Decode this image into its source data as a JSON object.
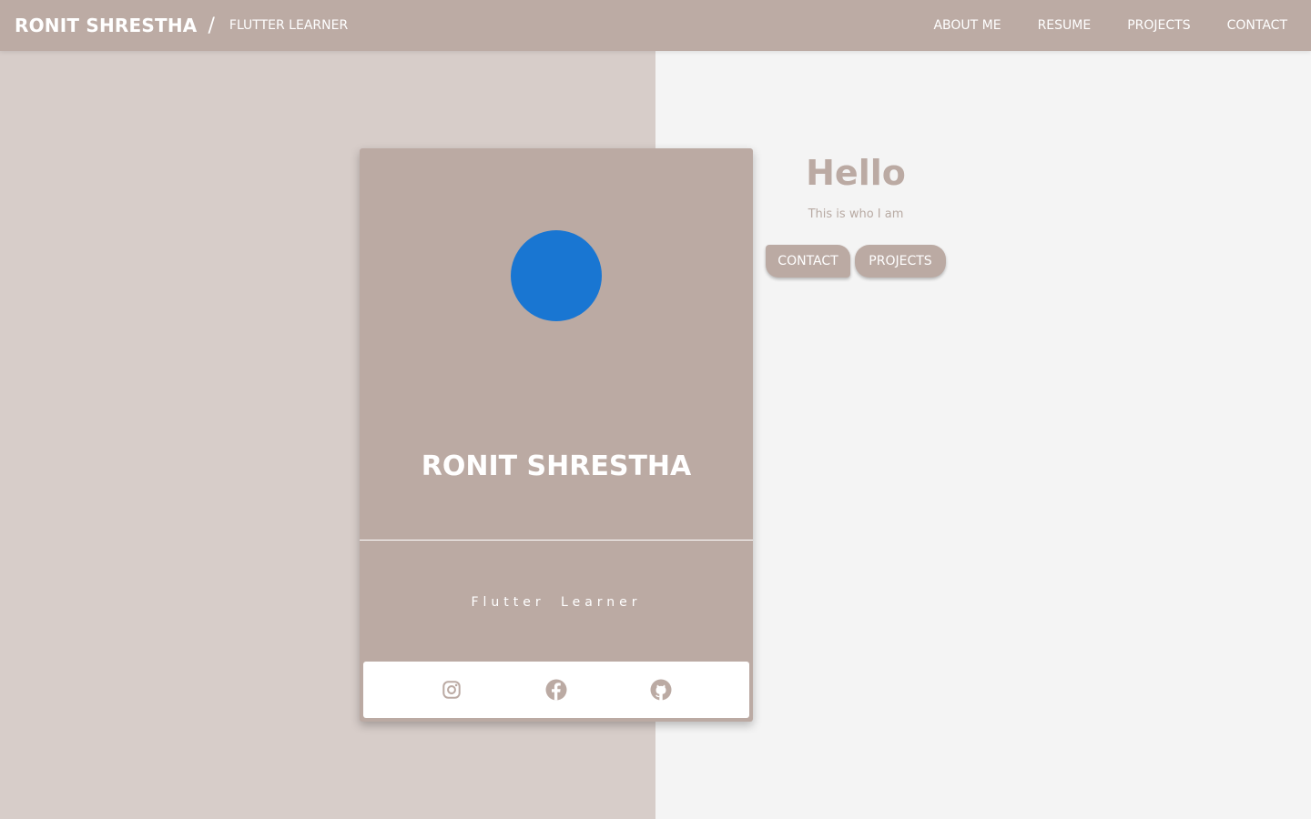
{
  "header": {
    "brand_name": "RONIT SHRESTHA",
    "separator": "/",
    "brand_subtitle": "FLUTTER LEARNER",
    "nav": [
      "ABOUT ME",
      "RESUME",
      "PROJECTS",
      "CONTACT"
    ]
  },
  "card": {
    "name": "RONIT SHRESTHA",
    "role": "Flutter Learner",
    "socials": [
      "instagram-icon",
      "facebook-icon",
      "github-icon"
    ]
  },
  "intro": {
    "greeting": "Hello",
    "subtitle": "This is who I am",
    "contact_label": "CONTACT",
    "projects_label": "PROJECTS"
  },
  "colors": {
    "header_bg": "#bcaba4",
    "card_bg": "#bbaaa3",
    "left_panel": "#d7cdc9",
    "right_panel": "#f4f4f4",
    "avatar": "#1976d2"
  }
}
